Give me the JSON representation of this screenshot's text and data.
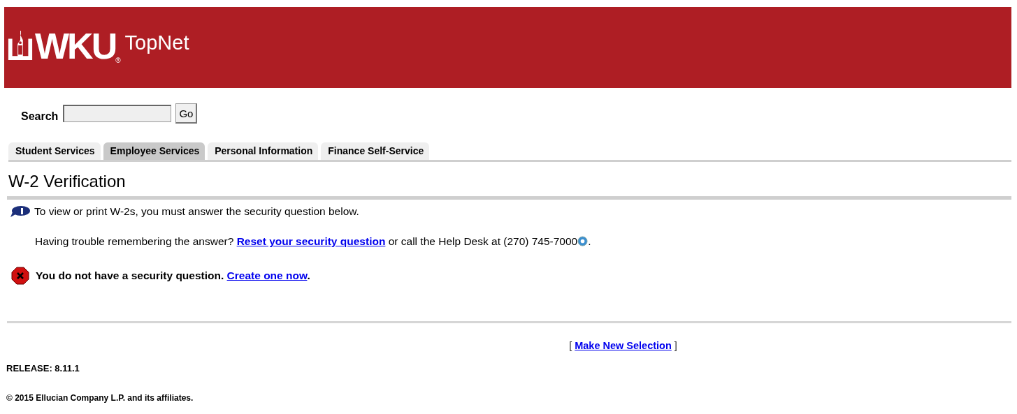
{
  "header": {
    "logo_text": "WKU",
    "logo_mark": "®",
    "app_title": "TopNet"
  },
  "search": {
    "label": "Search",
    "button": "Go"
  },
  "tabs": [
    {
      "label": "Student Services",
      "selected": false
    },
    {
      "label": "Employee Services",
      "selected": true
    },
    {
      "label": "Personal Information",
      "selected": false
    },
    {
      "label": "Finance Self-Service",
      "selected": false
    }
  ],
  "page_title": "W-2 Verification",
  "info_message": "To view or print W-2s, you must answer the security question below.",
  "help_text": {
    "before": "Having trouble remembering the answer? ",
    "link": "Reset your security question",
    "after": " or call the Help Desk at (270) 745-7000",
    "end": "."
  },
  "error_message": {
    "text": "You do not have a security question. ",
    "link": "Create one now",
    "end": "."
  },
  "make_new_selection": {
    "open": "[ ",
    "link": "Make New Selection",
    "close": " ]"
  },
  "release": "RELEASE: 8.11.1",
  "copyright": "© 2015 Ellucian Company L.P. and its affiliates."
}
